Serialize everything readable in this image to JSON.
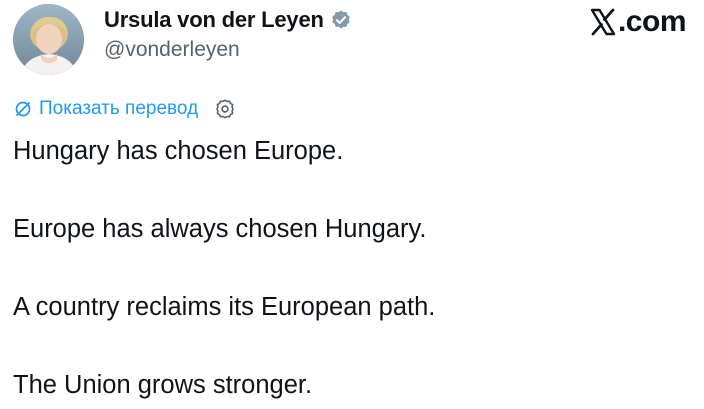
{
  "author": {
    "name": "Ursula von der Leyen",
    "handle": "@vonderleyen",
    "avatar_icon": "profile-photo",
    "verified_icon": "verified-badge-icon",
    "verified_color": "#829aab"
  },
  "brand": {
    "text": ".com",
    "logo_icon": "x-logo-icon"
  },
  "translate": {
    "label": "Показать перевод",
    "icon": "translate-icon",
    "settings_icon": "gear-icon",
    "link_color": "#1d9bf0"
  },
  "tweet": {
    "lines": [
      "Hungary has chosen Europe.",
      "Europe has always chosen Hungary.",
      "A country reclaims its European path.",
      "The Union grows stronger."
    ]
  }
}
